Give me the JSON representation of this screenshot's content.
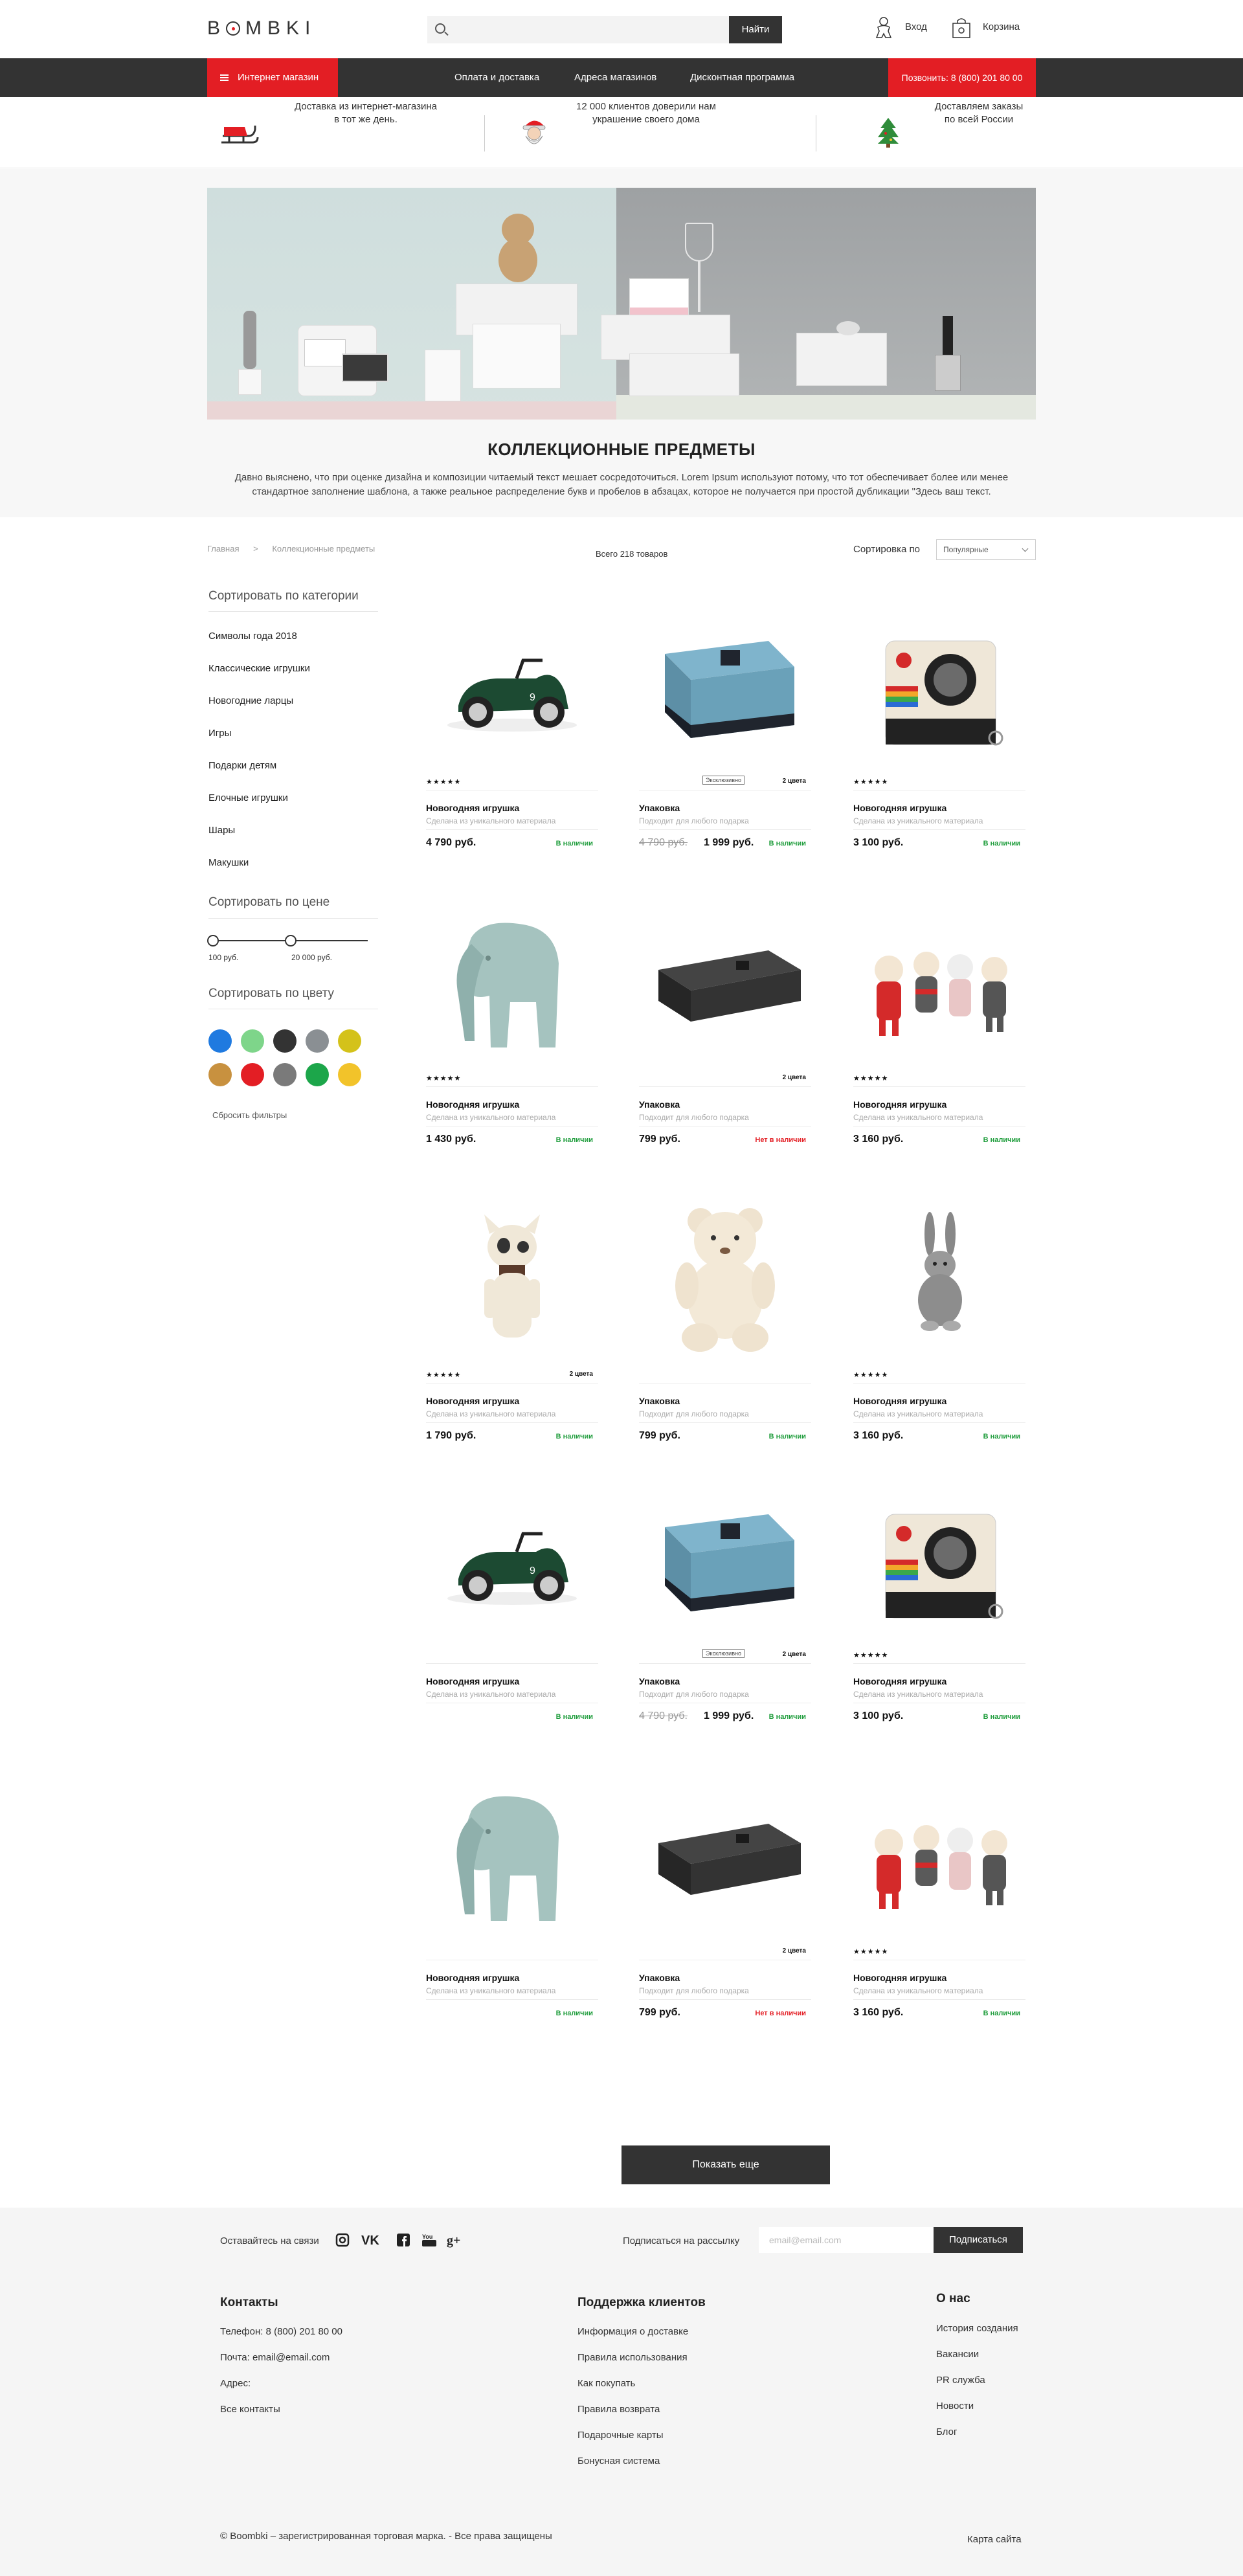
{
  "header": {
    "logo": "BOMBKI",
    "search_placeholder": "",
    "search_button": "Найти",
    "login": "Вход",
    "cart": "Корзина"
  },
  "nav": {
    "catalog": "Интернет магазин",
    "links": [
      "Оплата и доставка",
      "Адреса магазинов",
      "Дисконтная программа"
    ],
    "phone": "Позвонить: 8 (800) 201 80 00"
  },
  "benefits": [
    {
      "line1": "Доставка из интернет-магазина",
      "line2": "в тот же день.",
      "icon": "sleigh-icon"
    },
    {
      "line1": "12 000 клиентов доверили нам",
      "line2": "украшение своего дома",
      "icon": "santa-icon"
    },
    {
      "line1": "Доставляем заказы",
      "line2": "по всей России",
      "icon": "christmas-tree-icon"
    }
  ],
  "category": {
    "title": "КОЛЛЕКЦИОННЫЕ ПРЕДМЕТЫ",
    "description_1": "Давно выяснено, что при оценке дизайна и композиции читаемый текст мешает сосредоточиться. Lorem Ipsum используют потому, что тот обеспечивает более или менее",
    "description_2": "стандартное заполнение шаблона, а также реальное распределение букв и пробелов в абзацах, которое не получается при простой дубликации \"Здесь ваш текст."
  },
  "toolbar": {
    "breadcrumb": [
      "Главная",
      ">",
      "Коллекционные предметы"
    ],
    "total": "Всего 218 товаров",
    "sort_label": "Сортировка по",
    "sort_value": "Популярные"
  },
  "sidebar": {
    "category_title": "Сортировать по категории",
    "categories": [
      "Символы года 2018",
      "Классические игрушки",
      "Новогодние ларцы",
      "Игры",
      "Подарки детям",
      "Елочные игрушки",
      "Шары",
      "Макушки"
    ],
    "price_title": "Сортировать по цене",
    "price_min": "100 руб.",
    "price_max": "20 000 руб.",
    "price_range_fraction": [
      0.0,
      0.5
    ],
    "color_title": "Сортировать по цвету",
    "colors": [
      "#1f7ae0",
      "#7ed58a",
      "#333333",
      "#8a8f93",
      "#d4c21a",
      "#c8913f",
      "#e31e24",
      "#7a7a7a",
      "#1ca64a",
      "#f2c32a"
    ],
    "reset": "Сбросить фильтры"
  },
  "products": [
    {
      "kind": "car",
      "stars": "★★★★★",
      "badge": "",
      "colors": "",
      "name": "Новогодняя игрушка",
      "sub": "Сделана из уникального материала",
      "old_price": "",
      "price": "4 790 руб.",
      "stock": "В наличии",
      "in_stock": true
    },
    {
      "kind": "bluebox",
      "stars": "",
      "badge": "Эксклюзивно",
      "colors": "2 цвета",
      "name": "Упаковка",
      "sub": "Подходит для любого подарка",
      "old_price": "4 790 руб.",
      "price": "1 999 руб.",
      "stock": "В наличии",
      "in_stock": true
    },
    {
      "kind": "camera",
      "stars": "★★★★★",
      "badge": "",
      "colors": "",
      "name": "Новогодняя игрушка",
      "sub": "Сделана из уникального материала",
      "old_price": "",
      "price": "3 100 руб.",
      "stock": "В наличии",
      "in_stock": true
    },
    {
      "kind": "elephant",
      "stars": "★★★★★",
      "badge": "",
      "colors": "",
      "name": "Новогодняя игрушка",
      "sub": "Сделана из уникального материала",
      "old_price": "",
      "price": "1 430 руб.",
      "stock": "В наличии",
      "in_stock": true
    },
    {
      "kind": "blackbox",
      "stars": "",
      "badge": "",
      "colors": "2 цвета",
      "name": "Упаковка",
      "sub": "Подходит для любого подарка",
      "old_price": "",
      "price": "799 руб.",
      "stock": "Нет в наличии",
      "in_stock": false
    },
    {
      "kind": "dolls",
      "stars": "★★★★★",
      "badge": "",
      "colors": "",
      "name": "Новогодняя игрушка",
      "sub": "Сделана из уникального материала",
      "old_price": "",
      "price": "3 160 руб.",
      "stock": "В наличии",
      "in_stock": true
    },
    {
      "kind": "dog",
      "stars": "★★★★★",
      "badge": "",
      "colors": "2 цвета",
      "name": "Новогодняя игрушка",
      "sub": "Сделана из уникального материала",
      "old_price": "",
      "price": "1 790 руб.",
      "stock": "В наличии",
      "in_stock": true
    },
    {
      "kind": "teddy",
      "stars": "",
      "badge": "",
      "colors": "",
      "name": "Упаковка",
      "sub": "Подходит для любого подарка",
      "old_price": "",
      "price": "799 руб.",
      "stock": "В наличии",
      "in_stock": true
    },
    {
      "kind": "bunny",
      "stars": "★★★★★",
      "badge": "",
      "colors": "",
      "name": "Новогодняя игрушка",
      "sub": "Сделана из уникального материала",
      "old_price": "",
      "price": "3 160 руб.",
      "stock": "В наличии",
      "in_stock": true
    },
    {
      "kind": "car",
      "stars": "",
      "badge": "",
      "colors": "",
      "name": "Новогодняя игрушка",
      "sub": "Сделана из уникального материала",
      "old_price": "",
      "price": "",
      "stock": "В наличии",
      "in_stock": true
    },
    {
      "kind": "bluebox",
      "stars": "",
      "badge": "Эксклюзивно",
      "colors": "2 цвета",
      "name": "Упаковка",
      "sub": "Подходит для любого подарка",
      "old_price": "4 790 руб.",
      "price": "1 999 руб.",
      "stock": "В наличии",
      "in_stock": true
    },
    {
      "kind": "camera",
      "stars": "★★★★★",
      "badge": "",
      "colors": "",
      "name": "Новогодняя игрушка",
      "sub": "Сделана из уникального материала",
      "old_price": "",
      "price": "3 100 руб.",
      "stock": "В наличии",
      "in_stock": true
    },
    {
      "kind": "elephant",
      "stars": "",
      "badge": "",
      "colors": "",
      "name": "Новогодняя игрушка",
      "sub": "Сделана из уникального материала",
      "old_price": "",
      "price": "",
      "stock": "В наличии",
      "in_stock": true
    },
    {
      "kind": "blackbox",
      "stars": "",
      "badge": "",
      "colors": "2 цвета",
      "name": "Упаковка",
      "sub": "Подходит для любого подарка",
      "old_price": "",
      "price": "799 руб.",
      "stock": "Нет в наличии",
      "in_stock": false
    },
    {
      "kind": "dolls",
      "stars": "★★★★★",
      "badge": "",
      "colors": "",
      "name": "Новогодняя игрушка",
      "sub": "Сделана из уникального материала",
      "old_price": "",
      "price": "3 160 руб.",
      "stock": "В наличии",
      "in_stock": true
    }
  ],
  "show_more": "Показать еще",
  "footer": {
    "social_label": "Оставайтесь на связи",
    "social_icons": [
      "instagram-icon",
      "vk-icon",
      "facebook-icon",
      "youtube-icon",
      "google-plus-icon"
    ],
    "subscribe_label": "Подписаться на рассылку",
    "email_placeholder": "email@email.com",
    "subscribe_button": "Подписаться",
    "contacts_title": "Контакты",
    "contacts": [
      "Телефон: 8 (800) 201 80 00",
      "Почта: email@email.com",
      "Адрес:",
      "Все контакты"
    ],
    "support_title": "Поддержка клиентов",
    "support": [
      "Информация о доставке",
      "Правила использования",
      "Как покупать",
      "Правила возврата",
      "Подарочные карты",
      "Бонусная система"
    ],
    "about_title": "О нас",
    "about": [
      "История создания",
      "Вакансии",
      "PR служба",
      "Новости",
      "Блог"
    ],
    "copyright": "© Boombki – зарегистрированная торговая марка. - Все права защищены",
    "sitemap": "Карта сайта"
  }
}
